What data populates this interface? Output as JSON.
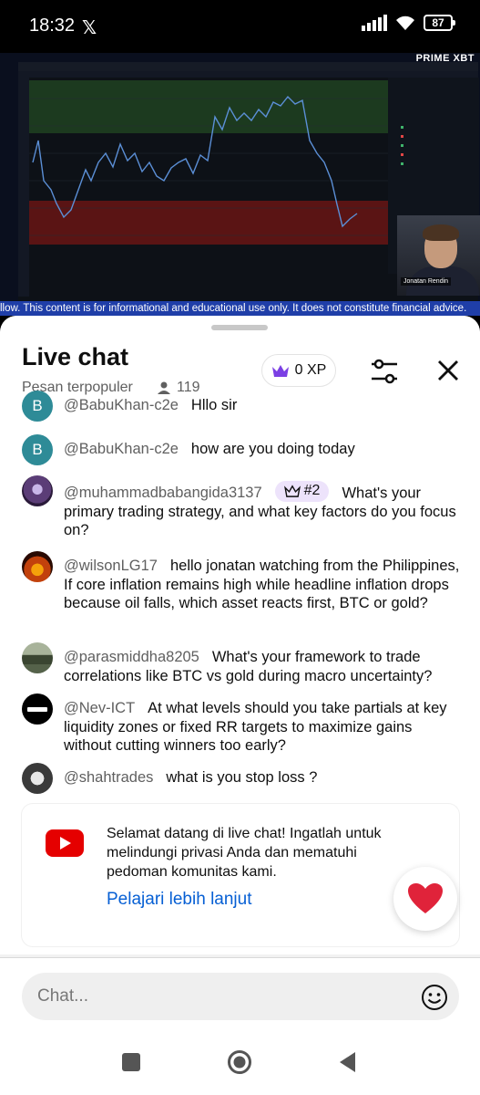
{
  "status_bar": {
    "time": "18:32",
    "x_logo": "𝕏",
    "battery": "87"
  },
  "video": {
    "brand": "PRIME XBT",
    "disclaimer": "llow. This content is for informational and educational use only. It does not constitute financial advice.",
    "streamer_name": "Jonatan Rendin"
  },
  "chat": {
    "title": "Live chat",
    "subtitle": "Pesan terpopuler",
    "viewer_count": "119",
    "xp_label": "0 XP"
  },
  "messages": [
    {
      "author": "@BabuKhan-c2e",
      "text": "Hllo sir",
      "avatar_letter": "B",
      "avatar_color": "#2e8b97"
    },
    {
      "author": "@BabuKhan-c2e",
      "text": "how are you doing today",
      "avatar_letter": "B",
      "avatar_color": "#2e8b97"
    },
    {
      "author": "@muhammadbabangida3137",
      "badge": "#2",
      "text": "What's your primary trading strategy, and what key factors do you focus on?",
      "avatar_color": "#5b3d77"
    },
    {
      "author": "@wilsonLG17",
      "text": "hello jonatan watching from the Philippines, If core inflation remains high while headline inflation drops because oil falls, which asset reacts first, BTC or gold?",
      "avatar_color": "#8a3a0c"
    },
    {
      "author": "@parasmiddha8205",
      "text": "What's your framework to trade correlations like BTC vs gold during macro uncertainty?",
      "avatar_color": "#55624a"
    },
    {
      "author": "@Nev-ICT",
      "text": "At what levels should you take partials at key liquidity zones or fixed RR targets to maximize gains without cutting winners too early?",
      "avatar_color": "#000000"
    },
    {
      "author": "@shahtrades",
      "text": "what is you stop loss ?",
      "avatar_color": "#3a3a3a"
    }
  ],
  "welcome": {
    "text": "Selamat datang di live chat! Ingatlah untuk melindungi privasi Anda dan mematuhi pedoman komunitas kami.",
    "link": "Pelajari lebih lanjut"
  },
  "composer": {
    "placeholder": "Chat..."
  },
  "colors": {
    "accent_link": "#065fd4",
    "badge_bg": "#ede3fb",
    "heart": "#e0233a"
  }
}
